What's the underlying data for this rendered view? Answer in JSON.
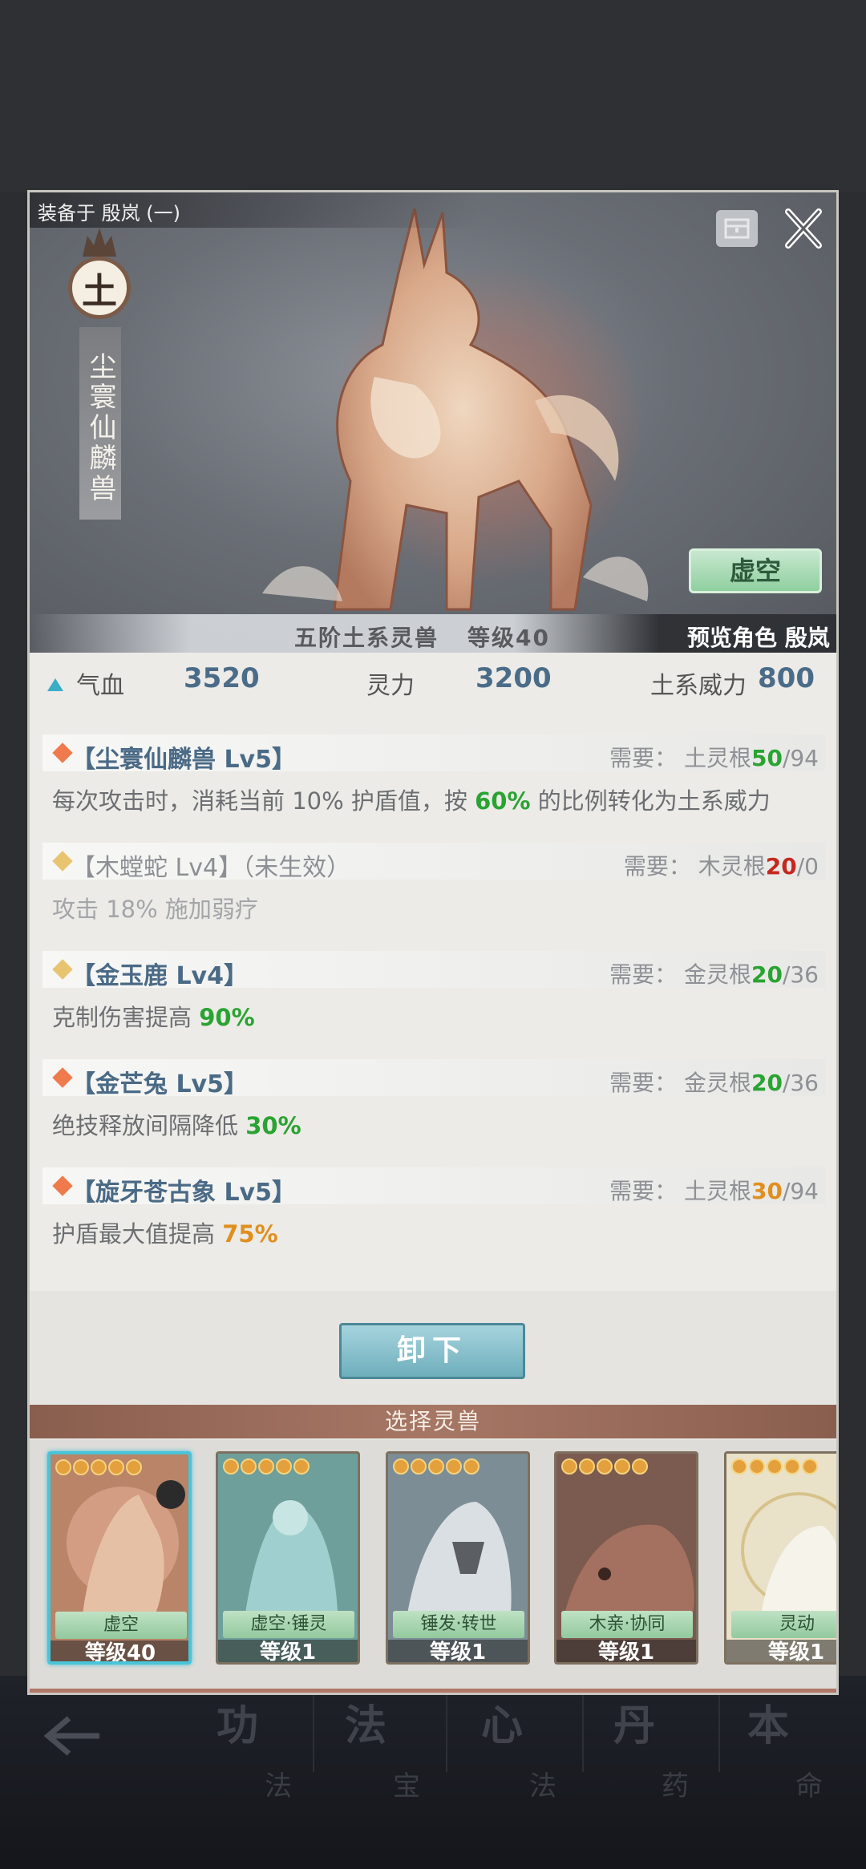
{
  "header": {
    "equipped_on": "装备于 殷岚 (一)",
    "element_char": "土",
    "beast_name": "尘寰仙麟兽",
    "mode_button": "虚空",
    "tier_text": "五阶土系灵兽",
    "level_text": "等级40",
    "preview_text": "预览角色 殷岚"
  },
  "stats": {
    "hp_label": "气血",
    "hp_value": "3520",
    "spirit_label": "灵力",
    "spirit_value": "3200",
    "power_label": "土系威力",
    "power_value": "800"
  },
  "skills": [
    {
      "name": "【尘寰仙麟兽 Lv5】",
      "req_prefix": "需要：  土灵根",
      "req_have": "50",
      "req_total": "/94",
      "desc_pre": "每次攻击时，消耗当前 10% 护盾值，按",
      "desc_hl": "60%",
      "desc_post": "的比例转化为土系威力"
    },
    {
      "name": "【木螳蛇 Lv4】（未生效）",
      "req_prefix": "需要：  木灵根",
      "req_have": "20",
      "req_total": "/0",
      "desc_pre": "攻击 18% 施加弱疗",
      "desc_hl": "",
      "desc_post": ""
    },
    {
      "name": "【金玉鹿 Lv4】",
      "req_prefix": "需要：  金灵根",
      "req_have": "20",
      "req_total": "/36",
      "desc_pre": "克制伤害提高",
      "desc_hl": "90%",
      "desc_post": ""
    },
    {
      "name": "【金芒兔 Lv5】",
      "req_prefix": "需要：  金灵根",
      "req_have": "20",
      "req_total": "/36",
      "desc_pre": "绝技释放间隔降低",
      "desc_hl": "30%",
      "desc_post": ""
    },
    {
      "name": "【旋牙苍古象 Lv5】",
      "req_prefix": "需要：  土灵根",
      "req_have": "30",
      "req_total": "/94",
      "desc_pre": "护盾最大值提高",
      "desc_hl": "75%",
      "desc_post": ""
    }
  ],
  "unequip_button": "卸下",
  "select_header": "选择灵兽",
  "cards": [
    {
      "tag": "虚空",
      "level": "等级40",
      "stars": 5,
      "bg": "#b98468"
    },
    {
      "tag": "虚空·锤灵",
      "level": "等级1",
      "stars": 5,
      "bg": "#6e9f9a"
    },
    {
      "tag": "锤发·转世",
      "level": "等级1",
      "stars": 5,
      "bg": "#7c8d96"
    },
    {
      "tag": "木亲·协同",
      "level": "等级1",
      "stars": 5,
      "bg": "#7b5a4f"
    },
    {
      "tag": "灵动",
      "level": "等级1",
      "stars": 5,
      "bg": "#e9e1c8"
    }
  ],
  "bottom_nav": [
    {
      "big": "功",
      "small": "法"
    },
    {
      "big": "法",
      "small": "宝"
    },
    {
      "big": "心",
      "small": "法"
    },
    {
      "big": "丹",
      "small": "药"
    },
    {
      "big": "本",
      "small": "命"
    }
  ],
  "colors": {
    "accent_blue": "#4b6c88",
    "highlight_green": "#2aa332",
    "highlight_red": "#c4281f",
    "highlight_orange": "#e08f1f",
    "selected_card_border": "#49c4d8"
  }
}
